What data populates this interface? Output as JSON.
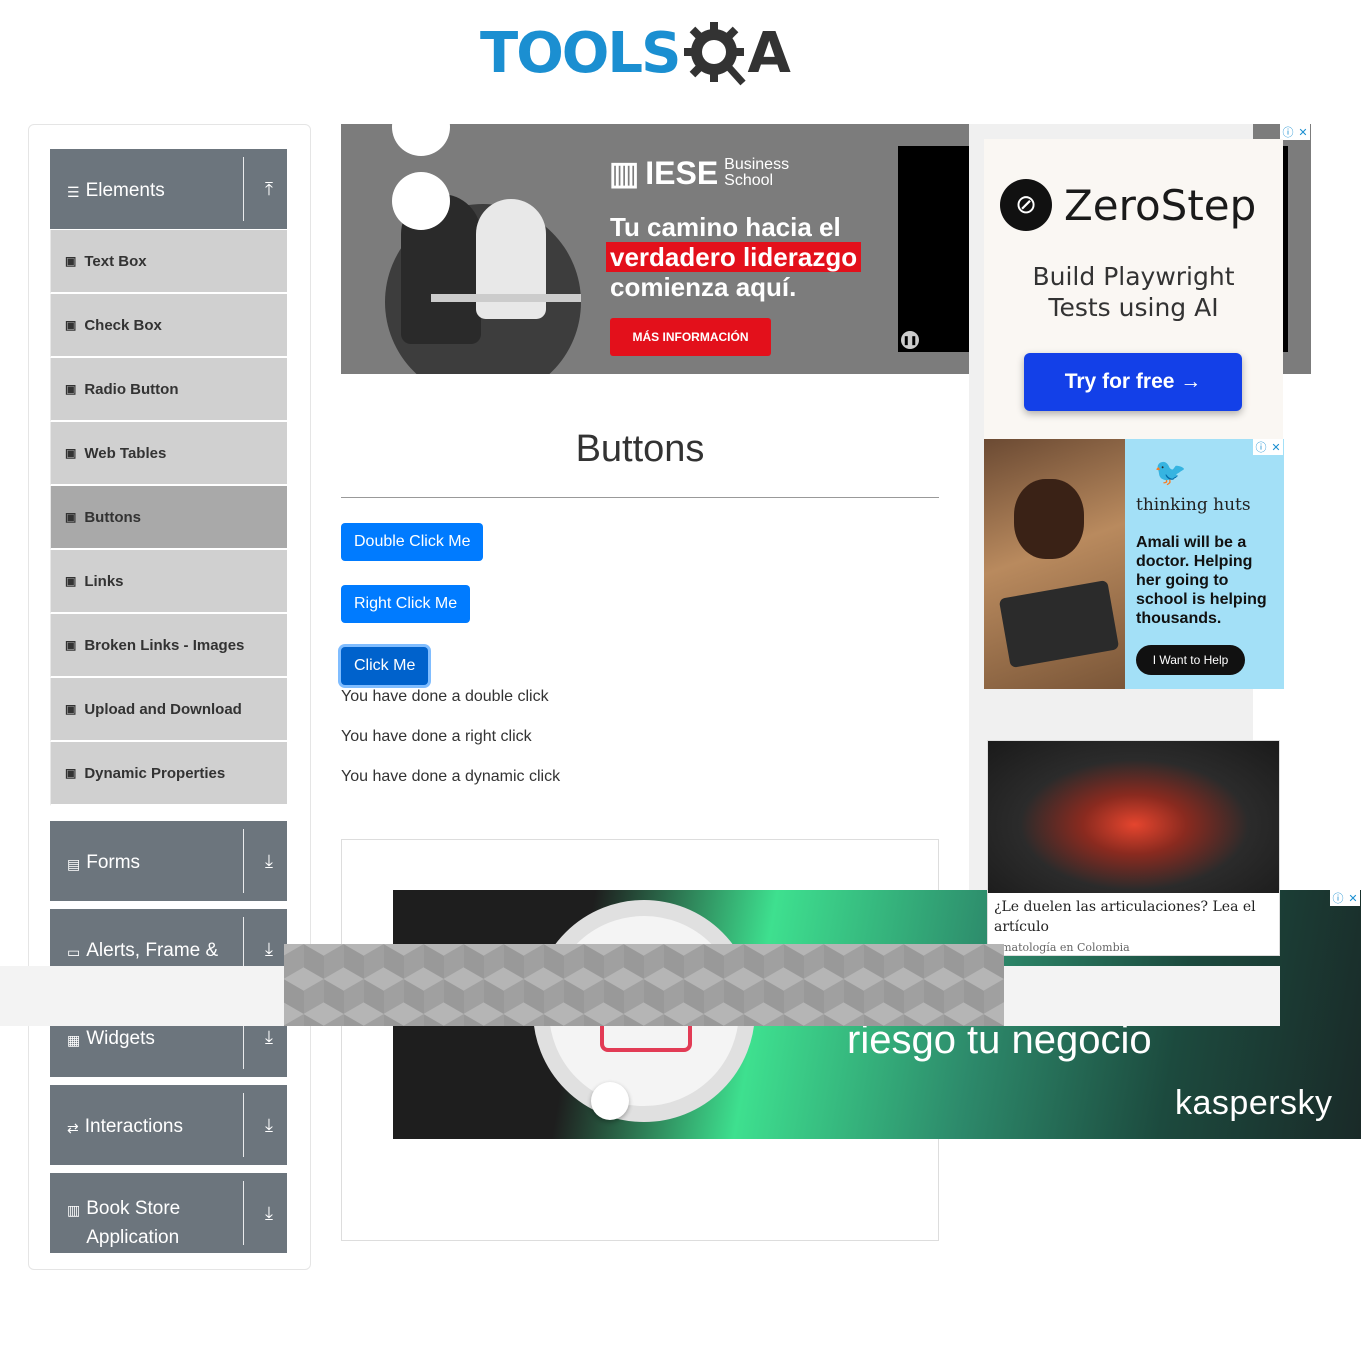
{
  "header": {
    "logo_text": "TOOLS",
    "logo_suffix": "A"
  },
  "sidebar": {
    "groups": [
      {
        "label": "Elements",
        "icon": "hamburger-icon",
        "arrow": "expand-up-icon"
      },
      {
        "label": "Forms",
        "icon": "form-icon",
        "arrow": "download-arrow-icon"
      },
      {
        "label": "Alerts, Frame &",
        "icon": "window-icon",
        "arrow": "download-arrow-icon"
      },
      {
        "label": "Widgets",
        "icon": "widgets-icon",
        "arrow": "download-arrow-icon"
      },
      {
        "label": "Interactions",
        "icon": "interactions-icon",
        "arrow": "download-arrow-icon"
      },
      {
        "label": "Book Store Application",
        "icon": "books-icon",
        "arrow": "download-arrow-icon"
      }
    ],
    "items": [
      {
        "label": "Text Box"
      },
      {
        "label": "Check Box"
      },
      {
        "label": "Radio Button"
      },
      {
        "label": "Web Tables"
      },
      {
        "label": "Buttons"
      },
      {
        "label": "Links"
      },
      {
        "label": "Broken Links - Images"
      },
      {
        "label": "Upload and Download"
      },
      {
        "label": "Dynamic Properties"
      }
    ]
  },
  "main": {
    "title": "Buttons",
    "buttons": {
      "double_click": "Double Click Me",
      "right_click": "Right Click Me",
      "click": "Click Me"
    },
    "messages": {
      "double": "You have done a double click",
      "right": "You have done a right click",
      "dynamic": "You have done a dynamic click"
    }
  },
  "ads": {
    "top": {
      "brand": "IESE",
      "brand_sub1": "Business",
      "brand_sub2": "School",
      "line1": "Tu camino hacia el",
      "line2": "verdadero liderazgo",
      "line3": "comienza aquí.",
      "cta": "MÁS INFORMACIÓN"
    },
    "zerostep": {
      "brand": "ZeroStep",
      "tagline1": "Build Playwright",
      "tagline2": "Tests using AI",
      "cta": "Try for free →"
    },
    "thinking_huts": {
      "brand": "thinking huts",
      "copy": "Amali will be a doctor. Helping her going to school is helping thousands.",
      "cta": "I Want to Help"
    },
    "knee": {
      "caption": "¿Le duelen las articulaciones? Lea el artículo",
      "source": "umatología en Colombia"
    },
    "kaspersky": {
      "text": "riesgo tu negocio",
      "logo": "kaspersky"
    }
  },
  "colors": {
    "primary_button": "#007bff",
    "sidebar_header": "#6c757d",
    "menu_item": "#d0d0d0",
    "menu_active": "#a9a9a9",
    "logo_blue": "#1b8fd1"
  }
}
